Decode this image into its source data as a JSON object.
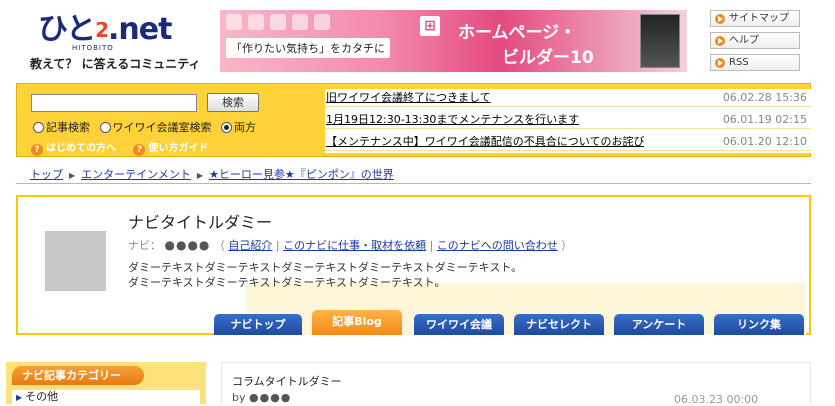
{
  "header": {
    "logo_text": "ひと",
    "logo_two": "2",
    "logo_net": ".net",
    "logo_sub": "HITOBITO",
    "tagline": "教えて？ に答えるコミュニティ",
    "banner": {
      "copy": "「作りたい気持ち」をカタチに",
      "title_line1": "ホームページ・",
      "title_line2": "ビルダー10"
    },
    "side_links": [
      "サイトマップ",
      "ヘルプ",
      "RSS"
    ]
  },
  "search": {
    "input_value": "",
    "button_label": "検索",
    "radios": [
      {
        "label": "記事検索",
        "checked": false
      },
      {
        "label": "ワイワイ会議室検索",
        "checked": false
      },
      {
        "label": "両方",
        "checked": true
      }
    ],
    "help_links": [
      "はじめての方へ",
      "使い方ガイド"
    ]
  },
  "news": [
    {
      "title": "旧ワイワイ会議終了につきまして",
      "date": "06.02.28 15:36"
    },
    {
      "title": "1月19日12:30-13:30までメンテナンスを行います",
      "date": "06.01.19 02:15"
    },
    {
      "title": "【メンテナンス中】ワイワイ会議配信の不具合についてのお詫び",
      "date": "06.01.20 12:10"
    }
  ],
  "breadcrumb": [
    "トップ",
    "エンターテインメント",
    "★ヒーロー見参★『ピンポン』の世界"
  ],
  "navi": {
    "title": "ナビタイトルダミー",
    "meta_label": "ナビ：",
    "author_dots": "●●●●",
    "links": [
      "自己紹介",
      "このナビに仕事・取材を依頼",
      "このナビへの問い合わせ"
    ],
    "desc_line1": "ダミーテキストダミーテキストダミーテキストダミーテキストダミーテキスト。",
    "desc_line2": "ダミーテキストダミーテキストダミーテキストダミーテキスト。",
    "tabs": [
      "ナビトップ",
      "記事Blog",
      "ワイワイ会議",
      "ナビセレクト",
      "アンケート",
      "リンク集"
    ],
    "active_tab": "記事Blog"
  },
  "category": {
    "heading": "ナビ記事カテゴリー",
    "items": [
      "その他"
    ]
  },
  "column": {
    "title": "コラムタイトルダミー",
    "by_label": "by",
    "by_dots": "●●●●",
    "date": "06.03.23 00:00"
  },
  "colors": {
    "accent_yellow": "#ffd23a",
    "tab_blue": "#1d4aa0",
    "tab_orange": "#f08a1a",
    "link_blue": "#1a3a9e"
  }
}
